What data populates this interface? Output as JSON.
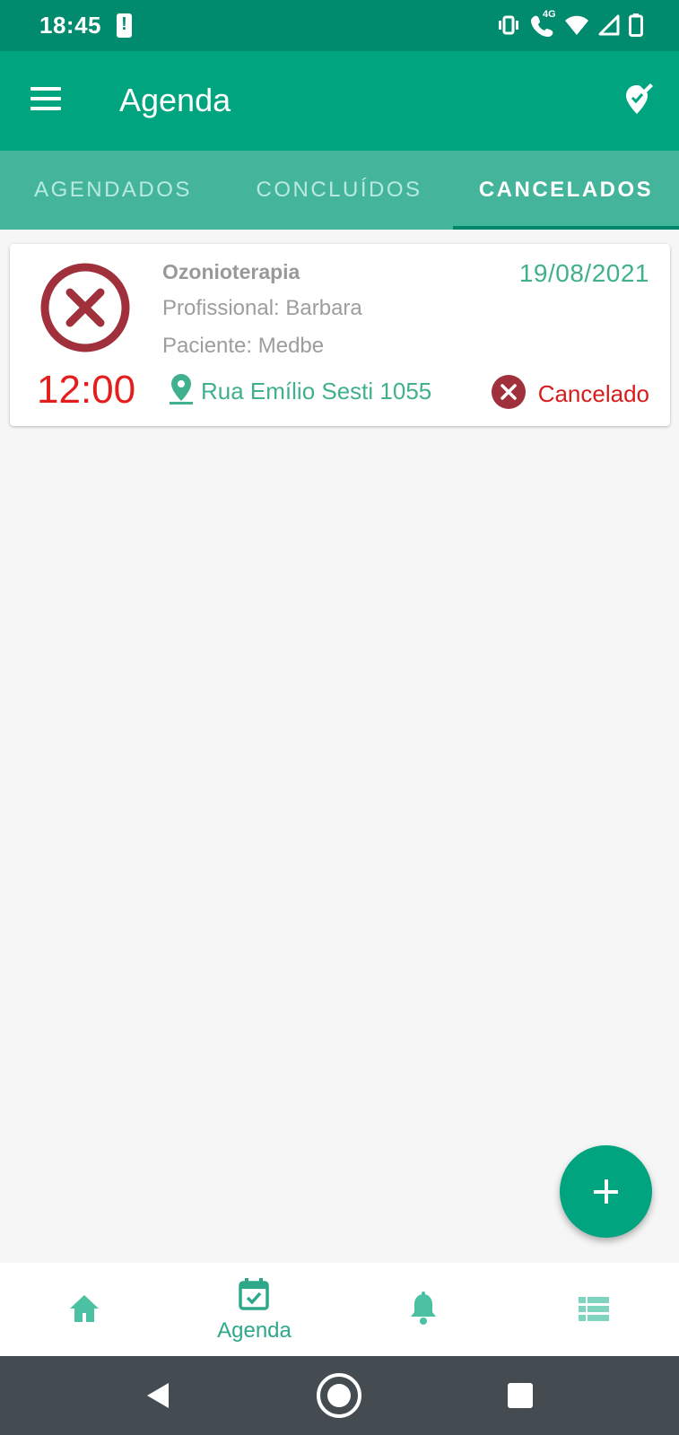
{
  "status_bar": {
    "time": "18:45",
    "icons": [
      "alert-icon",
      "vibrate-icon",
      "wifi-calling-icon",
      "wifi-icon",
      "signal-icon",
      "battery-icon"
    ],
    "network_label": "4G"
  },
  "app_bar": {
    "title": "Agenda",
    "left_icon": "menu-icon",
    "right_icon": "edit-location-icon"
  },
  "tabs": [
    {
      "label": "AGENDADOS",
      "active": false
    },
    {
      "label": "CONCLUÍDOS",
      "active": false
    },
    {
      "label": "CANCELADOS",
      "active": true
    }
  ],
  "appointments": [
    {
      "service": "Ozonioterapia",
      "date": "19/08/2021",
      "professional": "Profissional: Barbara",
      "patient": "Paciente: Medbe",
      "time": "12:00",
      "address": "Rua Emílio Sesti 1055",
      "status": "Cancelado",
      "status_icon": "cancel-circle-icon"
    }
  ],
  "fab": {
    "icon": "plus-icon"
  },
  "bottom_nav": {
    "items": [
      {
        "icon": "home-icon",
        "label": ""
      },
      {
        "icon": "calendar-check-icon",
        "label": "Agenda",
        "active": true
      },
      {
        "icon": "bell-icon",
        "label": ""
      },
      {
        "icon": "list-icon",
        "label": ""
      }
    ]
  },
  "system_nav": [
    "back-icon",
    "home-circle-icon",
    "recents-icon"
  ],
  "colors": {
    "status_bar": "#008a6e",
    "app_bar": "#00a47f",
    "tab_bar": "#44b59b",
    "accent_green": "#41b08e",
    "cancel_red": "#a0303c",
    "time_red": "#e41d1d",
    "system_nav": "#454c51"
  }
}
